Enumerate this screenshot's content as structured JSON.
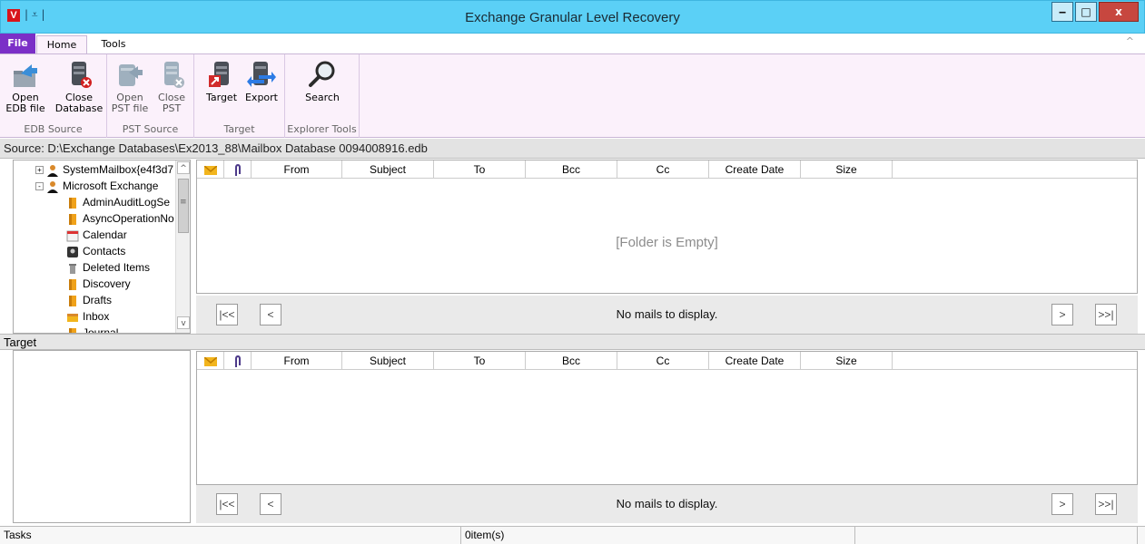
{
  "window": {
    "app_icon_letter": "V",
    "title": "Exchange Granular Level Recovery",
    "qat_glyph": "| ⩡ |",
    "min_glyph": "‒",
    "max_glyph": "□",
    "close_glyph": "x"
  },
  "ribbon": {
    "tabs": [
      "File",
      "Home",
      "Tools"
    ],
    "collapse_glyph": "^",
    "groups": [
      {
        "label": "EDB Source",
        "buttons": [
          {
            "label": "Open\nEDB file",
            "icon": "open-edb-icon"
          },
          {
            "label": "Close\nDatabase",
            "icon": "close-database-icon"
          }
        ]
      },
      {
        "label": "PST Source",
        "buttons": [
          {
            "label": "Open\nPST file",
            "icon": "open-pst-icon"
          },
          {
            "label": "Close\nPST",
            "icon": "close-pst-icon"
          }
        ]
      },
      {
        "label": "Target",
        "buttons": [
          {
            "label": "Target",
            "icon": "target-icon"
          },
          {
            "label": "Export",
            "icon": "export-icon"
          }
        ]
      },
      {
        "label": "Explorer Tools",
        "buttons": [
          {
            "label": "Search",
            "icon": "search-icon"
          }
        ]
      }
    ]
  },
  "source": {
    "path": "Source: D:\\Exchange Databases\\Ex2013_88\\Mailbox Database 0094008916.edb"
  },
  "tree": {
    "items": [
      {
        "label": "SystemMailbox{e4f3d7",
        "icon": "user-icon",
        "expander": "+"
      },
      {
        "label": "Microsoft Exchange",
        "icon": "user-icon",
        "expander": "-"
      },
      {
        "label": "AdminAuditLogSe",
        "icon": "folder-icon"
      },
      {
        "label": "AsyncOperationNo",
        "icon": "folder-icon"
      },
      {
        "label": "Calendar",
        "icon": "calendar-icon"
      },
      {
        "label": "Contacts",
        "icon": "contacts-icon"
      },
      {
        "label": "Deleted Items",
        "icon": "trash-icon"
      },
      {
        "label": "Discovery",
        "icon": "folder-icon"
      },
      {
        "label": "Drafts",
        "icon": "folder-icon"
      },
      {
        "label": "Inbox",
        "icon": "inbox-icon"
      },
      {
        "label": "Journal",
        "icon": "folder-icon"
      }
    ],
    "scroll_up": "^",
    "scroll_down": "v",
    "scroll_grip": "≡"
  },
  "grid": {
    "columns": [
      "",
      "",
      "From",
      "Subject",
      "To",
      "Bcc",
      "Cc",
      "Create Date",
      "Size"
    ],
    "empty_message": "[Folder is Empty]"
  },
  "pager": {
    "first": "|<<",
    "prev": "<",
    "next": ">",
    "last": ">>|",
    "message": "No mails to display."
  },
  "target": {
    "label": "Target",
    "grid_columns": [
      "",
      "",
      "From",
      "Subject",
      "To",
      "Bcc",
      "Cc",
      "Create Date",
      "Size"
    ],
    "pager_message": "No mails to display."
  },
  "status": {
    "tasks": "Tasks",
    "items": "0item(s)"
  },
  "colors": {
    "titlebar": "#5bd0f6",
    "file_tab": "#7b2fc7",
    "ribbon_bg": "#fbf1fb",
    "close_btn": "#c7473f"
  }
}
